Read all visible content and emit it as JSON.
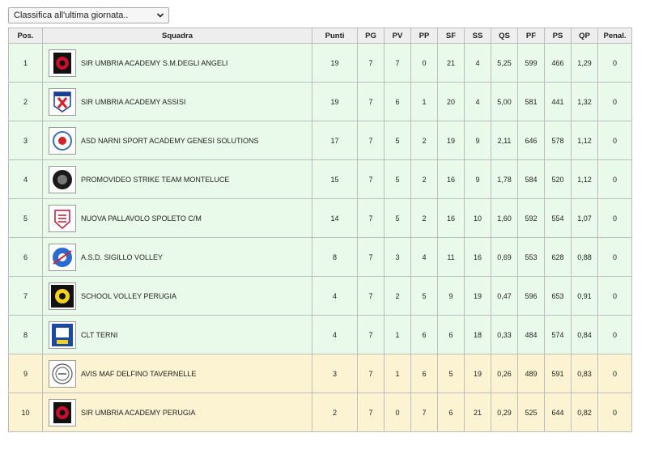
{
  "selector": {
    "value": "Classifica all'ultima giornata.."
  },
  "headers": [
    "Pos.",
    "Squadra",
    "Punti",
    "PG",
    "PV",
    "PP",
    "SF",
    "SS",
    "QS",
    "PF",
    "PS",
    "QP",
    "Penal."
  ],
  "rows": [
    {
      "pos": "1",
      "team": "SIR UMBRIA ACADEMY S.M.DEGLI ANGELI",
      "logo": "sir-umbria-logo",
      "punti": "19",
      "pg": "7",
      "pv": "7",
      "pp": "0",
      "sf": "21",
      "ss": "4",
      "qs": "5,25",
      "pf": "599",
      "ps": "466",
      "qp": "1,29",
      "penal": "0"
    },
    {
      "pos": "2",
      "team": "SIR UMBRIA ACADEMY ASSISI",
      "logo": "assisi-logo",
      "punti": "19",
      "pg": "7",
      "pv": "6",
      "pp": "1",
      "sf": "20",
      "ss": "4",
      "qs": "5,00",
      "pf": "581",
      "ps": "441",
      "qp": "1,32",
      "penal": "0"
    },
    {
      "pos": "3",
      "team": "ASD NARNI SPORT ACADEMY GENESI SOLUTIONS",
      "logo": "narni-logo",
      "punti": "17",
      "pg": "7",
      "pv": "5",
      "pp": "2",
      "sf": "19",
      "ss": "9",
      "qs": "2,11",
      "pf": "646",
      "ps": "578",
      "qp": "1,12",
      "penal": "0"
    },
    {
      "pos": "4",
      "team": "PROMOVIDEO STRIKE TEAM MONTELUCE",
      "logo": "strike-team-logo",
      "punti": "15",
      "pg": "7",
      "pv": "5",
      "pp": "2",
      "sf": "16",
      "ss": "9",
      "qs": "1,78",
      "pf": "584",
      "ps": "520",
      "qp": "1,12",
      "penal": "0"
    },
    {
      "pos": "5",
      "team": "NUOVA PALLAVOLO SPOLETO C/M",
      "logo": "spoleto-logo",
      "punti": "14",
      "pg": "7",
      "pv": "5",
      "pp": "2",
      "sf": "16",
      "ss": "10",
      "qs": "1,60",
      "pf": "592",
      "ps": "554",
      "qp": "1,07",
      "penal": "0"
    },
    {
      "pos": "6",
      "team": "A.S.D. SIGILLO VOLLEY",
      "logo": "sigillo-logo",
      "punti": "8",
      "pg": "7",
      "pv": "3",
      "pp": "4",
      "sf": "11",
      "ss": "16",
      "qs": "0,69",
      "pf": "553",
      "ps": "628",
      "qp": "0,88",
      "penal": "0"
    },
    {
      "pos": "7",
      "team": "SCHOOL VOLLEY PERUGIA",
      "logo": "school-volley-logo",
      "punti": "4",
      "pg": "7",
      "pv": "2",
      "pp": "5",
      "sf": "9",
      "ss": "19",
      "qs": "0,47",
      "pf": "596",
      "ps": "653",
      "qp": "0,91",
      "penal": "0"
    },
    {
      "pos": "8",
      "team": "CLT TERNI",
      "logo": "clt-logo",
      "punti": "4",
      "pg": "7",
      "pv": "1",
      "pp": "6",
      "sf": "6",
      "ss": "18",
      "qs": "0,33",
      "pf": "484",
      "ps": "574",
      "qp": "0,84",
      "penal": "0"
    },
    {
      "pos": "9",
      "team": "AVIS MAF DELFINO TAVERNELLE",
      "logo": "avis-logo",
      "punti": "3",
      "pg": "7",
      "pv": "1",
      "pp": "6",
      "sf": "5",
      "ss": "19",
      "qs": "0,26",
      "pf": "489",
      "ps": "591",
      "qp": "0,83",
      "penal": "0"
    },
    {
      "pos": "10",
      "team": "SIR UMBRIA ACADEMY PERUGIA",
      "logo": "sir-umbria-logo",
      "punti": "2",
      "pg": "7",
      "pv": "0",
      "pp": "7",
      "sf": "6",
      "ss": "21",
      "qs": "0,29",
      "pf": "525",
      "ps": "644",
      "qp": "0,82",
      "penal": "0"
    }
  ],
  "colors": {
    "zone_green": "#eafaea",
    "zone_yellow": "#fbf3d2",
    "header_bg": "#eeeeee",
    "border": "#bdbdbd"
  }
}
